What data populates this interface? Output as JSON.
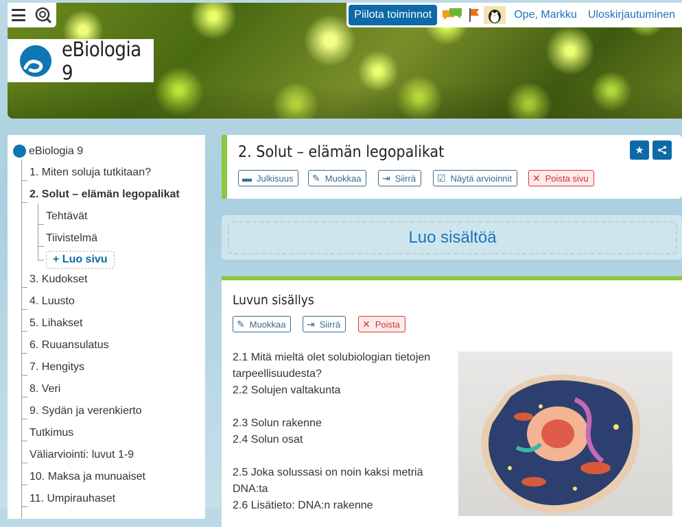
{
  "header": {
    "hide_button": "Piilota toiminnot",
    "user_link": "Ope, Markku",
    "logout_link": "Uloskirjautuminen",
    "logo_text": "eBiologia 9"
  },
  "sidebar": {
    "root": "eBiologia 9",
    "items": [
      {
        "label": "1. Miten soluja tutkitaan?"
      },
      {
        "label": "2. Solut – elämän legopalikat"
      },
      {
        "label": "Tehtävät"
      },
      {
        "label": "Tiivistelmä"
      },
      {
        "label": "+ Luo sivu"
      },
      {
        "label": "3. Kudokset"
      },
      {
        "label": "4. Luusto"
      },
      {
        "label": "5. Lihakset"
      },
      {
        "label": "6. Ruuansulatus"
      },
      {
        "label": "7. Hengitys"
      },
      {
        "label": "8. Veri"
      },
      {
        "label": "9. Sydän ja verenkierto"
      },
      {
        "label": "Tutkimus"
      },
      {
        "label": "Väliarviointi: luvut 1-9"
      },
      {
        "label": "10. Maksa ja munuaiset"
      },
      {
        "label": "11. Umpirauhaset"
      }
    ]
  },
  "page": {
    "title": "2. Solut – elämän legopalikat",
    "tools": [
      "Julkisuus",
      "Muokkaa",
      "Siirrä",
      "Näytä arvioinnit",
      "Poista sivu"
    ]
  },
  "create": {
    "label": "Luo sisältöä"
  },
  "toc": {
    "title": "Luvun sisällys",
    "tools": [
      "Muokkaa",
      "Siirrä",
      "Poista"
    ],
    "lines": [
      "2.1 Mitä mieltä olet solubiologian tietojen tarpeellisuudesta?",
      "2.2 Solujen valtakunta",
      "",
      "2.3 Solun rakenne",
      "2.4 Solun osat",
      "",
      "2.5 Joka solussasi on noin kaksi metriä DNA:ta",
      "2.6 Lisätieto: DNA:n rakenne"
    ]
  }
}
